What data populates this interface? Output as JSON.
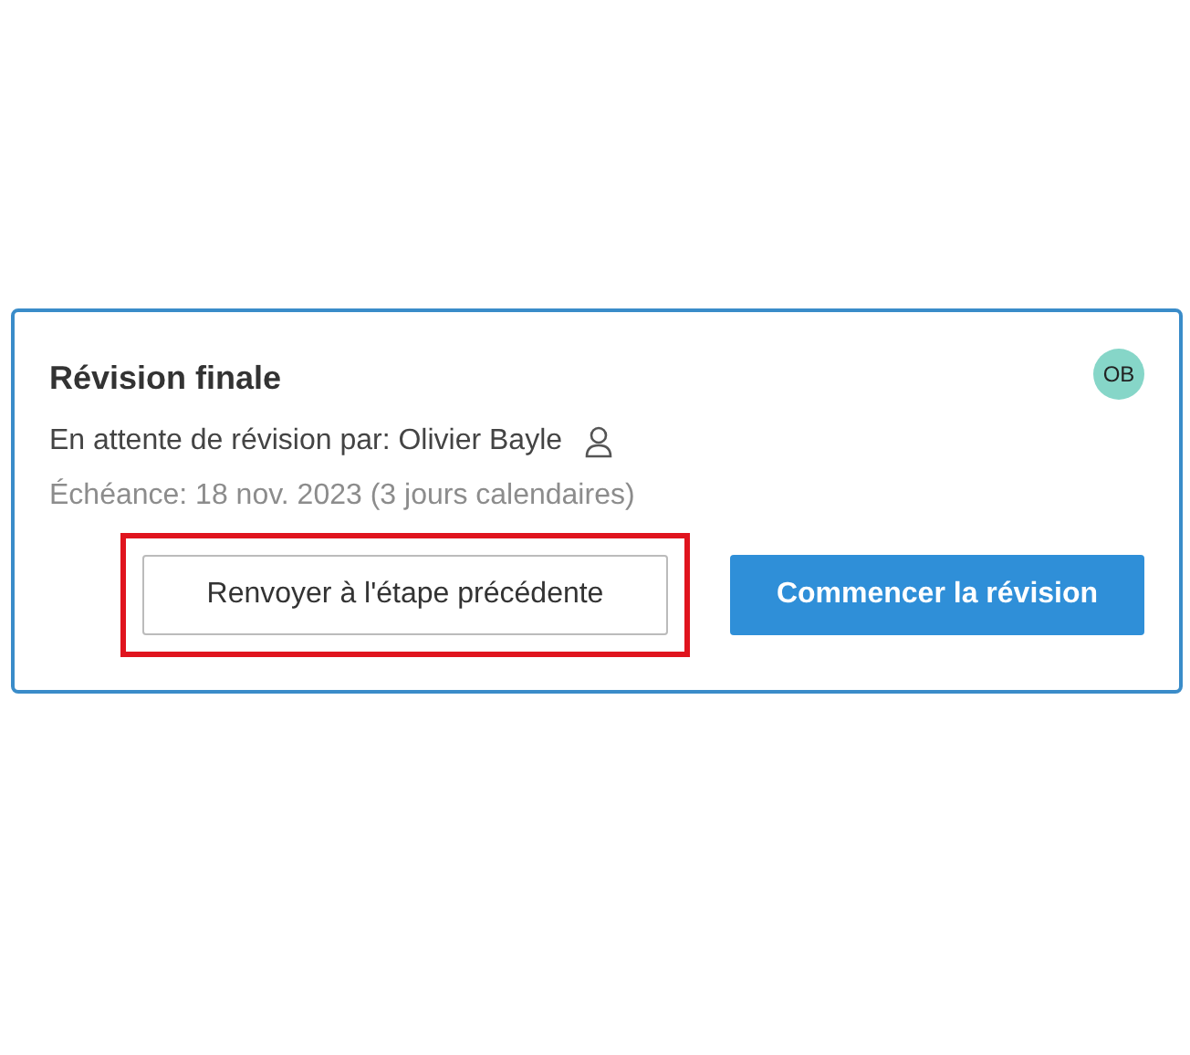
{
  "card": {
    "title": "Révision finale",
    "avatar": {
      "initials": "OB",
      "color": "#86d6c8"
    },
    "waiting": "En attente de révision par: Olivier Bayle",
    "due": "Échéance: 18 nov. 2023 (3 jours calendaires)",
    "buttons": [
      {
        "label": "Renvoyer à l'étape précédente",
        "kind": "secondary",
        "highlighted": true
      },
      {
        "label": "Commencer la révision",
        "kind": "primary",
        "highlighted": false
      }
    ]
  }
}
